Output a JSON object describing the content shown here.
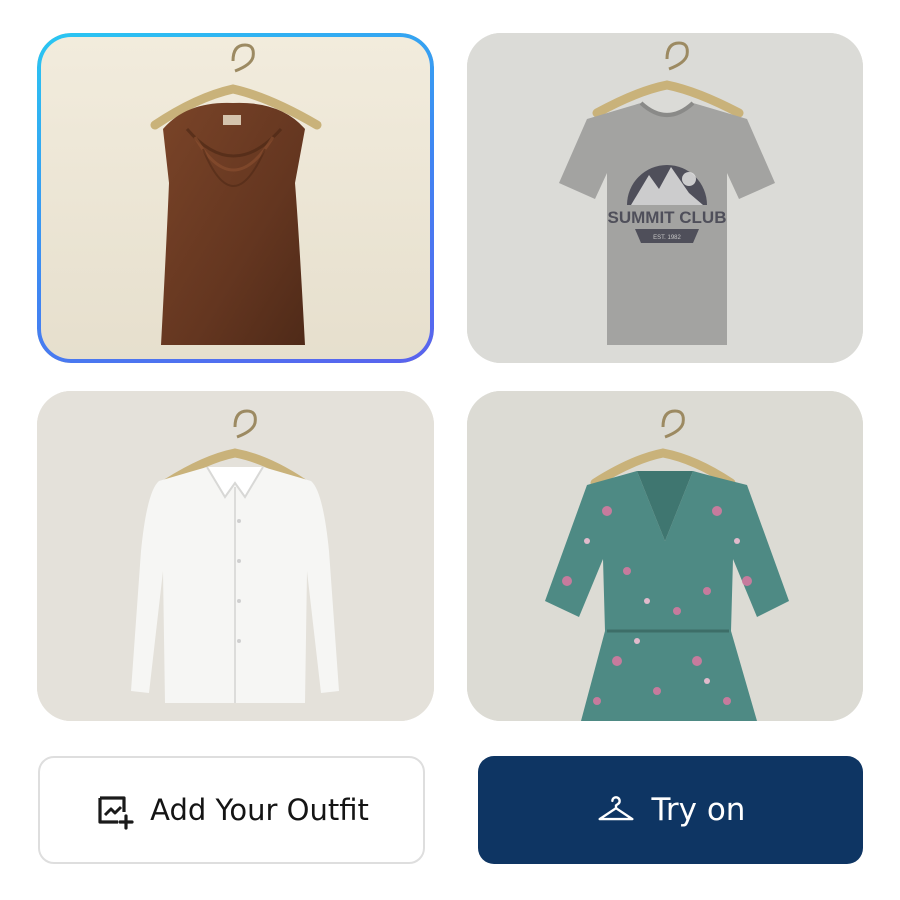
{
  "grid": {
    "items": [
      {
        "id": "brown-cowl-tank",
        "selected": true,
        "garment_color": "#6a3a22"
      },
      {
        "id": "grey-summit-tee",
        "selected": false,
        "garment_color": "#9c9c9a",
        "graphic_text": "SUMMIT CLUB",
        "graphic_subtext": "EST. 1982"
      },
      {
        "id": "white-shirt",
        "selected": false,
        "garment_color": "#f4f4f2"
      },
      {
        "id": "floral-dress",
        "selected": false,
        "garment_color": "#4e8a84"
      }
    ]
  },
  "actions": {
    "add_outfit_label": "Add Your Outfit",
    "try_on_label": "Try on"
  },
  "colors": {
    "selection_border_start": "#29c7f2",
    "selection_border_end": "#5a62ee",
    "primary_button": "#0e3563"
  },
  "icons": {
    "add_outfit": "add-image-icon",
    "try_on": "hanger-icon"
  }
}
